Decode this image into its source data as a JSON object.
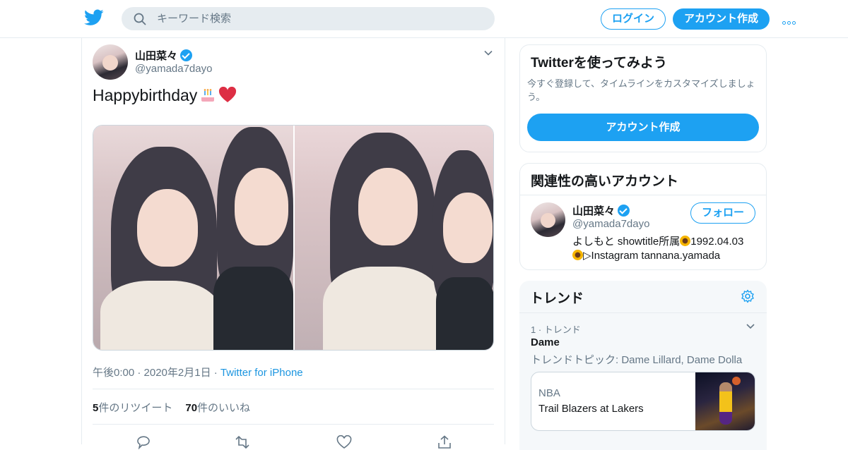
{
  "header": {
    "search_placeholder": "キーワード検索",
    "login_label": "ログイン",
    "signup_label": "アカウント作成"
  },
  "tweet": {
    "author_name": "山田菜々",
    "author_handle": "@yamada7dayo",
    "text": "Happybirthday",
    "time": "午後0:00 · 2020年2月1日 · ",
    "source": "Twitter for iPhone",
    "retweet_count": "5",
    "retweet_label": "件のリツイート",
    "like_count": "70",
    "like_label": "件のいいね"
  },
  "sidebar": {
    "try": {
      "title": "Twitterを使ってみよう",
      "subtitle": "今すぐ登録して、タイムラインをカスタマイズしましょう。",
      "button": "アカウント作成"
    },
    "related": {
      "title": "関連性の高いアカウント",
      "name": "山田菜々",
      "handle": "@yamada7dayo",
      "follow_label": "フォロー",
      "bio_part1": "よしもと showtitle所属",
      "bio_part2": "1992.04.03",
      "bio_part3": "▷Instagram tannana.yamada"
    },
    "trends": {
      "title": "トレンド",
      "rank": "1 · トレンド",
      "name": "Dame",
      "topic": "トレンドトピック: Dame Lillard, Dame Dolla",
      "event_category": "NBA",
      "event_title": "Trail Blazers at Lakers"
    }
  },
  "colors": {
    "accent": "#1da1f2",
    "secondary_text": "#657786",
    "border": "#e6ecf0"
  }
}
